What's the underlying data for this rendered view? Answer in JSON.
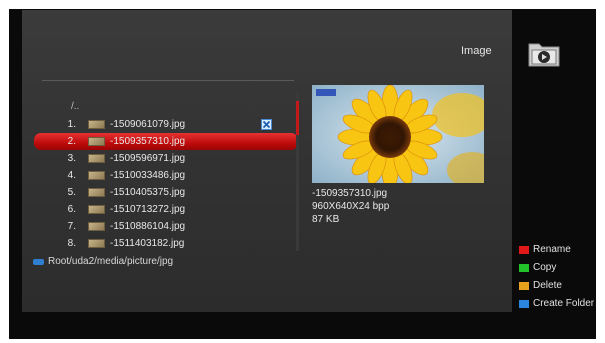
{
  "header": {
    "title": "Image",
    "folder_icon": "folder-play-icon"
  },
  "browser": {
    "parent_dir": "/..",
    "files": [
      {
        "num": "1.",
        "name": "-1509061079.jpg",
        "marked": true
      },
      {
        "num": "2.",
        "name": "-1509357310.jpg",
        "selected": true
      },
      {
        "num": "3.",
        "name": "-1509596971.jpg"
      },
      {
        "num": "4.",
        "name": "-1510033486.jpg"
      },
      {
        "num": "5.",
        "name": "-1510405375.jpg"
      },
      {
        "num": "6.",
        "name": "-1510713272.jpg"
      },
      {
        "num": "7.",
        "name": "-1510886104.jpg"
      },
      {
        "num": "8.",
        "name": "-1511403182.jpg"
      }
    ],
    "path": "Root/uda2/media/picture/jpg"
  },
  "preview": {
    "filename": "-1509357310.jpg",
    "resolution": "960X640X24 bpp",
    "size": "87 KB"
  },
  "legend": [
    {
      "label": "Rename",
      "color": "#e01818"
    },
    {
      "label": "Copy",
      "color": "#22c32a"
    },
    {
      "label": "Delete",
      "color": "#e6a21a"
    },
    {
      "label": "Create Folder",
      "color": "#2a86dc"
    }
  ],
  "colors": {
    "selection": "#c71414",
    "panel": "#363636",
    "screen": "#0a0a0a"
  }
}
